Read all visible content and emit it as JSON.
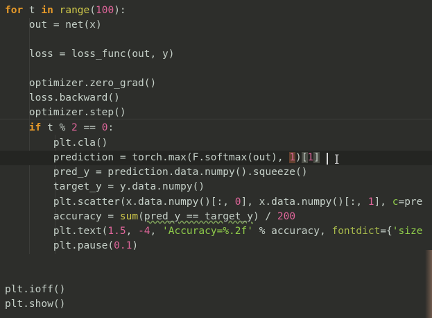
{
  "editor": {
    "lines": [
      [
        {
          "t": "for",
          "c": "kw"
        },
        {
          "t": " t "
        },
        {
          "t": "in",
          "c": "kw"
        },
        {
          "t": " "
        },
        {
          "t": "range",
          "c": "kw2"
        },
        {
          "t": "("
        },
        {
          "t": "100",
          "c": "num"
        },
        {
          "t": "):"
        }
      ],
      [
        {
          "t": "    out = net(x)"
        }
      ],
      [],
      [
        {
          "t": "    loss = loss_func(out, y)"
        }
      ],
      [],
      [
        {
          "t": "    optimizer.zero_grad()"
        }
      ],
      [
        {
          "t": "    loss.backward()"
        }
      ],
      [
        {
          "t": "    optimizer.step()"
        }
      ],
      [
        {
          "t": "    "
        },
        {
          "t": "if",
          "c": "kw"
        },
        {
          "t": " t % "
        },
        {
          "t": "2",
          "c": "num"
        },
        {
          "t": " == "
        },
        {
          "t": "0",
          "c": "num"
        },
        {
          "t": ":"
        }
      ],
      [
        {
          "t": "        plt.cla()"
        }
      ],
      [
        {
          "t": "        prediction = torch.max(F.softmax(out), "
        },
        {
          "t": "1",
          "c": "num hl"
        },
        {
          "t": ")"
        },
        {
          "t": "[",
          "c": "hl2"
        },
        {
          "t": "1",
          "c": "num"
        },
        {
          "t": "]",
          "c": "hl2"
        }
      ],
      [
        {
          "t": "        pred_y = prediction.data.numpy().squeeze()"
        }
      ],
      [
        {
          "t": "        target_y = y.data.numpy()"
        }
      ],
      [
        {
          "t": "        plt.scatter(x.data.numpy()[:, "
        },
        {
          "t": "0",
          "c": "num"
        },
        {
          "t": "], x.data.numpy()[:, "
        },
        {
          "t": "1",
          "c": "num"
        },
        {
          "t": "], "
        },
        {
          "t": "c",
          "c": "str"
        },
        {
          "t": "=pre"
        }
      ],
      [
        {
          "t": "        accuracy = "
        },
        {
          "t": "sum",
          "c": "kw2"
        },
        {
          "t": "("
        },
        {
          "t": "pred_y == target_y",
          "c": "wave"
        },
        {
          "t": ") / "
        },
        {
          "t": "200",
          "c": "num"
        }
      ],
      [
        {
          "t": "        plt.text("
        },
        {
          "t": "1.5",
          "c": "num"
        },
        {
          "t": ", "
        },
        {
          "t": "-4",
          "c": "num"
        },
        {
          "t": ", "
        },
        {
          "t": "'Accuracy=%.2f'",
          "c": "str"
        },
        {
          "t": " % accuracy, "
        },
        {
          "t": "fontdict",
          "c": "fn"
        },
        {
          "t": "={"
        },
        {
          "t": "'size",
          "c": "str"
        }
      ],
      [
        {
          "t": "        plt.pause("
        },
        {
          "t": "0.1",
          "c": "num"
        },
        {
          "t": ")"
        }
      ],
      [],
      [],
      [
        {
          "t": "plt.ioff()"
        }
      ],
      [
        {
          "t": "plt.show()"
        }
      ]
    ]
  }
}
